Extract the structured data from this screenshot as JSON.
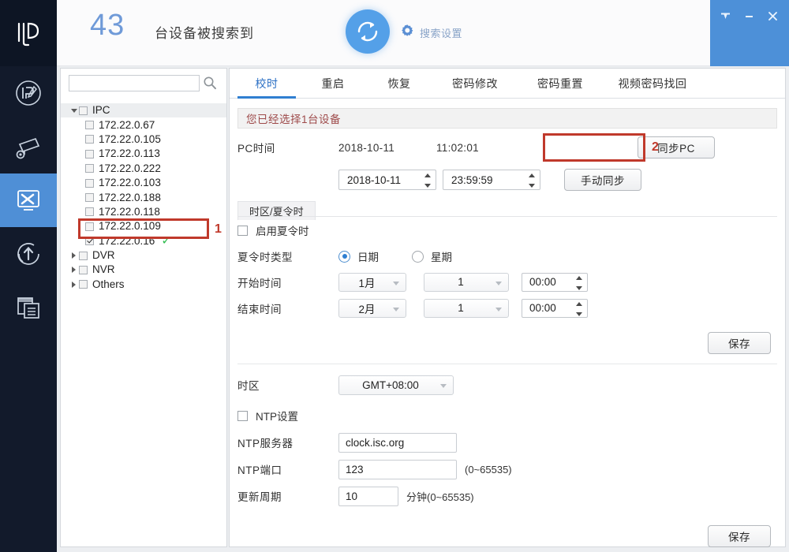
{
  "header": {
    "device_count": "43",
    "count_label": "台设备被搜索到",
    "refresh_icon": "refresh-icon",
    "settings_icon": "gear-icon",
    "settings_label": "搜索设置",
    "window_buttons": [
      {
        "name": "dropdown-button",
        "glyph": "▼"
      },
      {
        "name": "minimize-button",
        "glyph": "—"
      },
      {
        "name": "close-button",
        "glyph": "✕"
      }
    ],
    "accent_blue": "#4d90d8"
  },
  "rail": {
    "logo_name": "app-logo",
    "items": [
      {
        "name": "sidebar-item-ip-config",
        "icon": "ip-pencil-icon",
        "active": false
      },
      {
        "name": "sidebar-item-camera",
        "icon": "camera-gear-icon",
        "active": false
      },
      {
        "name": "sidebar-item-tools",
        "icon": "monitor-tools-icon",
        "active": true
      },
      {
        "name": "sidebar-item-upgrade",
        "icon": "upload-arrow-icon",
        "active": false
      },
      {
        "name": "sidebar-item-logs",
        "icon": "documents-icon",
        "active": false
      }
    ]
  },
  "tree": {
    "search_placeholder": "",
    "search_value": "",
    "search_icon": "search-icon",
    "nodes": [
      {
        "label": "IPC",
        "level": 0,
        "expanded": true,
        "checked": false,
        "selected": true
      },
      {
        "label": "172.22.0.67",
        "level": 1,
        "checked": false
      },
      {
        "label": "172.22.0.105",
        "level": 1,
        "checked": false
      },
      {
        "label": "172.22.0.113",
        "level": 1,
        "checked": false
      },
      {
        "label": "172.22.0.222",
        "level": 1,
        "checked": false
      },
      {
        "label": "172.22.0.103",
        "level": 1,
        "checked": false
      },
      {
        "label": "172.22.0.188",
        "level": 1,
        "checked": false
      },
      {
        "label": "172.22.0.118",
        "level": 1,
        "checked": false
      },
      {
        "label": "172.22.0.109",
        "level": 1,
        "checked": false
      },
      {
        "label": "172.22.0.16",
        "level": 1,
        "checked": true,
        "ok": "✓"
      },
      {
        "label": "DVR",
        "level": 0,
        "expanded": false,
        "checked": false
      },
      {
        "label": "NVR",
        "level": 0,
        "expanded": false,
        "checked": false
      },
      {
        "label": "Others",
        "level": 0,
        "expanded": false,
        "checked": false
      }
    ]
  },
  "annotations": {
    "callout_1": "1",
    "callout_2": "2",
    "color": "#c0392b"
  },
  "tabs": [
    {
      "label": "校时",
      "active": true
    },
    {
      "label": "重启",
      "active": false
    },
    {
      "label": "恢复",
      "active": false
    },
    {
      "label": "密码修改",
      "active": false
    },
    {
      "label": "密码重置",
      "active": false
    },
    {
      "label": "视频密码找回",
      "active": false
    }
  ],
  "notice": "您已经选择1台设备",
  "time_section": {
    "pc_time_label": "PC时间",
    "pc_date": "2018-10-11",
    "pc_clock": "11:02:01",
    "sync_pc_button": "同步PC",
    "manual_date": "2018-10-11",
    "manual_time": "23:59:59",
    "manual_sync_button": "手动同步"
  },
  "dst_section": {
    "chip_label": "时区/夏令时",
    "enable_label": "启用夏令时",
    "enable_checked": false,
    "type_label": "夏令时类型",
    "type_options": [
      {
        "label": "日期",
        "selected": true
      },
      {
        "label": "星期",
        "selected": false
      }
    ],
    "start_label": "开始时间",
    "start_month": "1月",
    "start_day": "1",
    "start_time": "00:00",
    "end_label": "结束时间",
    "end_month": "2月",
    "end_day": "1",
    "end_time": "00:00",
    "save_button": "保存"
  },
  "ntp_section": {
    "timezone_label": "时区",
    "timezone_value": "GMT+08:00",
    "ntp_enable_label": "NTP设置",
    "ntp_enable_checked": false,
    "server_label": "NTP服务器",
    "server_value": "clock.isc.org",
    "port_label": "NTP端口",
    "port_value": "123",
    "port_hint": "(0~65535)",
    "interval_label": "更新周期",
    "interval_value": "10",
    "interval_hint": "分钟(0~65535)",
    "save_button": "保存"
  }
}
